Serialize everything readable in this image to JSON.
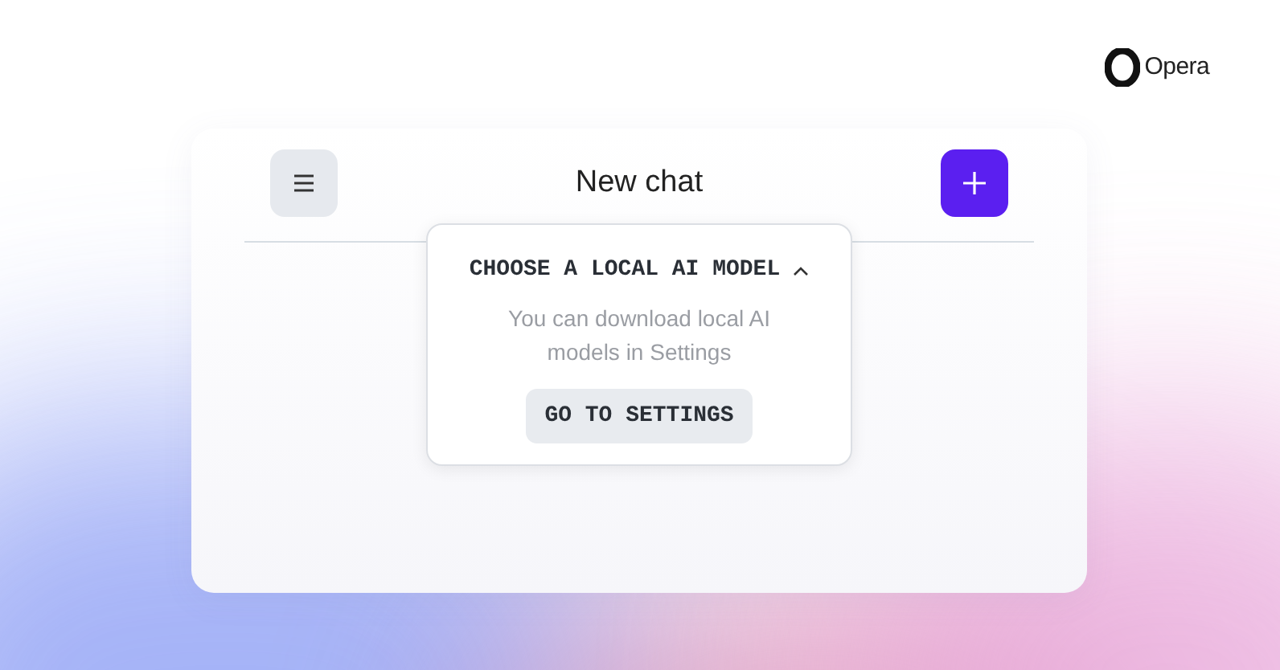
{
  "brand": {
    "name": "Opera"
  },
  "chat": {
    "title": "New chat"
  },
  "model_popover": {
    "title": "CHOOSE A LOCAL AI MODEL",
    "expanded": true,
    "message": "You can download local AI models in Settings",
    "button": "GO TO SETTINGS"
  }
}
